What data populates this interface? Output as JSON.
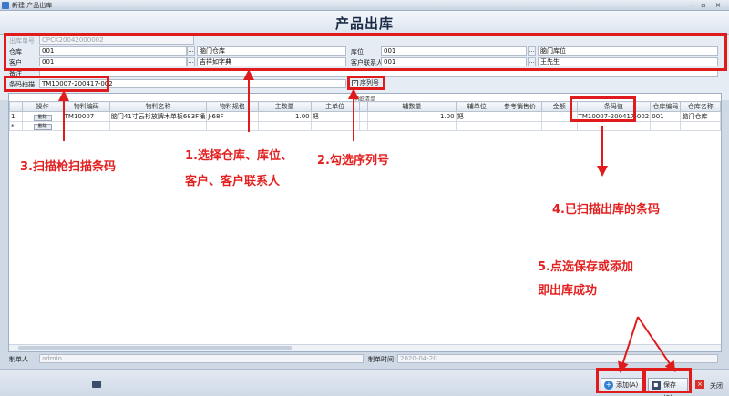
{
  "window": {
    "title": "新建 产品出库"
  },
  "header": {
    "title": "产品出库"
  },
  "form": {
    "doc_no_label": "出库单号",
    "doc_no_value": "CPCK20042000002",
    "warehouse_label": "仓库",
    "warehouse_code": "001",
    "warehouse_name": "脑门仓库",
    "location_label": "库位",
    "location_code": "001",
    "location_name": "脑门库位",
    "customer_label": "客户",
    "customer_code": "001",
    "customer_name": "吉祥如字典",
    "contact_label": "客户联系人",
    "contact_code": "001",
    "contact_name": "王先生",
    "remark_label": "备注",
    "barcode_label": "条码扫描",
    "barcode_value": "TM10007-200417-002",
    "serial_checkbox_label": "序列号",
    "ellipsis": "..."
  },
  "grid": {
    "caption": "明细清单",
    "columns": [
      "",
      "操作",
      "物料编码",
      "物料名称",
      "物料规格",
      "主数量",
      "主单位",
      "",
      "辅数量",
      "辅单位",
      "参考销售价",
      "金额",
      "条码值",
      "仓库编码",
      "仓库名称"
    ],
    "delete_label": "删除",
    "rows": [
      {
        "idx": "1",
        "code": "TM10007",
        "name": "脑门41寸云杉放牌木单板683F桶",
        "spec": "J-68F",
        "qty": "1.00",
        "unit": "把",
        "aux_qty": "1.00",
        "aux_unit": "把",
        "price": "",
        "amount": "",
        "barcode": "TM10007-200417-002",
        "wh_code": "001",
        "wh_name": "脑门仓库"
      }
    ],
    "new_row_marker": "*"
  },
  "footer": {
    "creator_label": "制单人",
    "creator_value": "admin",
    "time_label": "制单时间",
    "time_value": "2020-04-20"
  },
  "buttons": {
    "add": "添加(A)",
    "save": "保存(S)",
    "close": "关闭"
  },
  "annotations": {
    "a1_line1": "1.选择仓库、库位、",
    "a1_line2": "客户、客户联系人",
    "a2": "2.勾选序列号",
    "a3": "3.扫描枪扫描条码",
    "a4": "4.已扫描出库的条码",
    "a5_line1": "5.点选保存或添加",
    "a5_line2": "即出库成功"
  },
  "colors": {
    "annotation": "#e01b1b",
    "accent": "#3b79c8"
  }
}
